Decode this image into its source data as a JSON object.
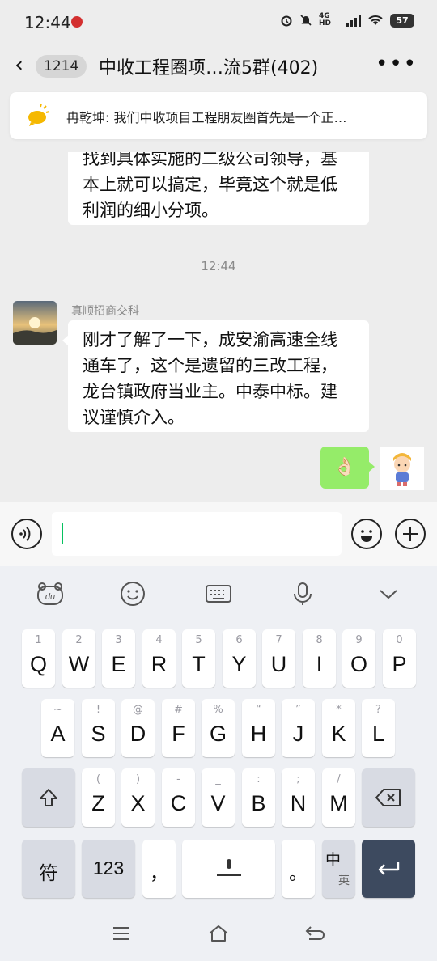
{
  "status": {
    "time": "12:44",
    "network": "4G HD",
    "battery": "57"
  },
  "header": {
    "unread_count": "1214",
    "title": "中收工程圈项…流5群(402)"
  },
  "notice": {
    "text": "冉乾坤: 我们中收项目工程朋友圈首先是一个正…"
  },
  "messages": [
    {
      "lines": [
        "找到具体实施的二级公司领导，基",
        "本上就可以搞定，毕竟这个就是低",
        "利润的细小分项。"
      ]
    },
    {
      "timestamp": "12:44"
    },
    {
      "sender": "真顺招商交科",
      "lines": [
        "刚才了解了一下，成安渝高速全线",
        "通车了，这个是遗留的三改工程，",
        "龙台镇政府当业主。中泰中标。建",
        "议谨慎介入。"
      ]
    },
    {
      "self": true,
      "emoji": "👌🏻"
    }
  ],
  "keyboard": {
    "row1": [
      [
        "1",
        "Q"
      ],
      [
        "2",
        "W"
      ],
      [
        "3",
        "E"
      ],
      [
        "4",
        "R"
      ],
      [
        "5",
        "T"
      ],
      [
        "6",
        "Y"
      ],
      [
        "7",
        "U"
      ],
      [
        "8",
        "I"
      ],
      [
        "9",
        "O"
      ],
      [
        "0",
        "P"
      ]
    ],
    "row2": [
      [
        "~",
        "A"
      ],
      [
        "!",
        "S"
      ],
      [
        "@",
        "D"
      ],
      [
        "#",
        "F"
      ],
      [
        "%",
        "G"
      ],
      [
        "“",
        "H"
      ],
      [
        "”",
        "J"
      ],
      [
        "*",
        "K"
      ],
      [
        "?",
        "L"
      ]
    ],
    "row3": [
      [
        "(",
        "Z"
      ],
      [
        ")",
        "X"
      ],
      [
        "-",
        "C"
      ],
      [
        "_",
        "V"
      ],
      [
        ":",
        "B"
      ],
      [
        ";",
        "N"
      ],
      [
        "/",
        "M"
      ]
    ],
    "symbol_label": "符",
    "number_label": "123",
    "comma_label": "，",
    "period_label": "。",
    "lang_main": "中",
    "lang_sub": "英",
    "toolbar_logo": "du"
  }
}
